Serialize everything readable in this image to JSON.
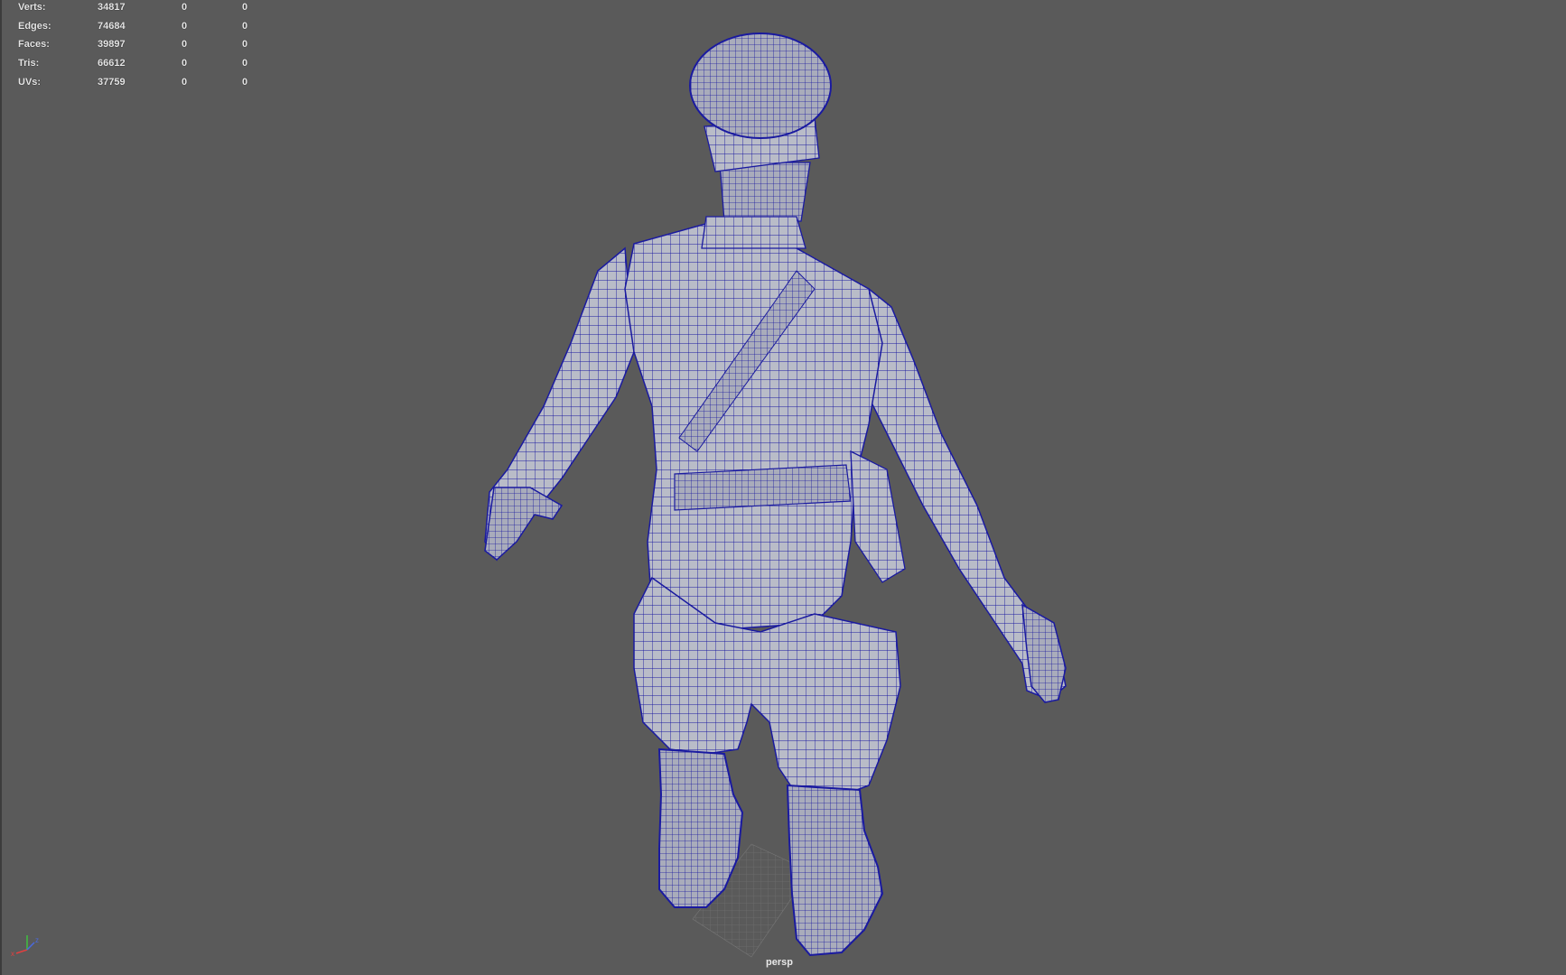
{
  "hud": {
    "rows": [
      {
        "label": "Verts:",
        "value": "34817",
        "a": "0",
        "b": "0"
      },
      {
        "label": "Edges:",
        "value": "74684",
        "a": "0",
        "b": "0"
      },
      {
        "label": "Faces:",
        "value": "39897",
        "a": "0",
        "b": "0"
      },
      {
        "label": "Tris:",
        "value": "66612",
        "a": "0",
        "b": "0"
      },
      {
        "label": "UVs:",
        "value": "37759",
        "a": "0",
        "b": "0"
      }
    ]
  },
  "camera": {
    "name": "persp"
  },
  "axis": {
    "x_label": "x",
    "y_label": "y",
    "z_label": "z"
  },
  "colors": {
    "background": "#5a5a5a",
    "wireframe": "#1a1aa0",
    "shading": "#b9bcc8",
    "hud_text": "#e6e6e6"
  }
}
